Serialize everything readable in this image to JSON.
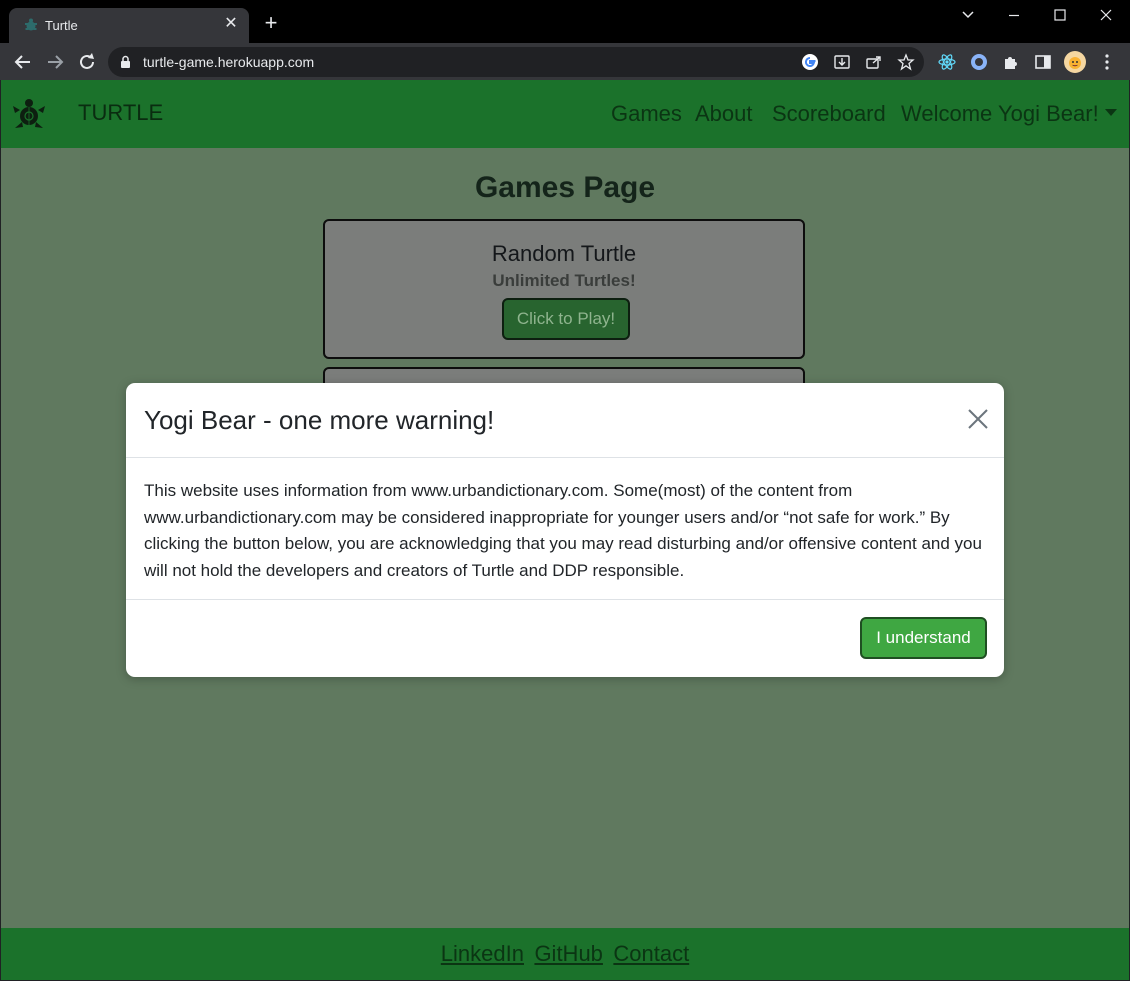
{
  "browser": {
    "tab_title": "Turtle",
    "url": "turtle-game.herokuapp.com"
  },
  "navbar": {
    "brand": "TURTLE",
    "links": [
      "Games",
      "About",
      "Scoreboard"
    ],
    "user_menu": "Welcome Yogi Bear!"
  },
  "main": {
    "page_title": "Games Page",
    "cards": [
      {
        "title": "Random Turtle",
        "subtitle": "Unlimited Turtles!",
        "button": "Click to Play!"
      }
    ]
  },
  "modal": {
    "title": "Yogi Bear - one more warning!",
    "body": "This website uses information from www.urbandictionary.com. Some(most) of the content from www.urbandictionary.com may be considered inappropriate for younger users and/or “not safe for work.” By clicking the button below, you are acknowledging that you may read disturbing and/or offensive content and you will not hold the developers and creators of Turtle and DDP responsible.",
    "confirm_button": "I understand"
  },
  "footer": {
    "links": [
      "LinkedIn",
      "GitHub",
      "Contact"
    ]
  },
  "colors": {
    "navbar": "#1b722b",
    "page_bg_dimmed": "#60795f",
    "modal_button": "#3fa742"
  }
}
